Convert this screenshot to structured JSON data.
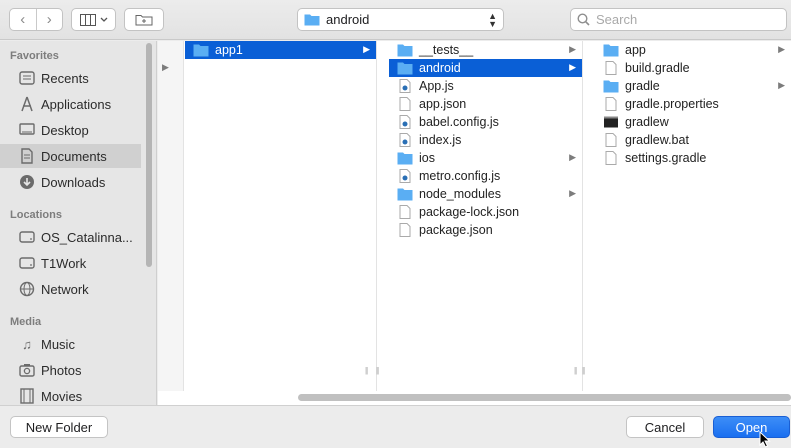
{
  "toolbar": {
    "path": "android",
    "search_placeholder": "Search"
  },
  "sidebar": {
    "favorites_title": "Favorites",
    "favorites": [
      {
        "label": "Recents",
        "icon": "clock-icon"
      },
      {
        "label": "Applications",
        "icon": "applications-icon"
      },
      {
        "label": "Desktop",
        "icon": "desktop-icon"
      },
      {
        "label": "Documents",
        "icon": "document-icon",
        "active": true
      },
      {
        "label": "Downloads",
        "icon": "download-icon"
      }
    ],
    "locations_title": "Locations",
    "locations": [
      {
        "label": "OS_Catalinna...",
        "icon": "disk-icon"
      },
      {
        "label": "T1Work",
        "icon": "disk-icon"
      },
      {
        "label": "Network",
        "icon": "network-icon"
      }
    ],
    "media_title": "Media",
    "media": [
      {
        "label": "Music",
        "icon": "music-icon"
      },
      {
        "label": "Photos",
        "icon": "camera-icon"
      },
      {
        "label": "Movies",
        "icon": "film-icon"
      }
    ]
  },
  "columns": {
    "col1": [
      {
        "name": "app1",
        "type": "folder",
        "selected": true,
        "has_children": true
      }
    ],
    "col2": [
      {
        "name": "__tests__",
        "type": "folder",
        "has_children": true
      },
      {
        "name": "android",
        "type": "folder",
        "selected": true,
        "has_children": true
      },
      {
        "name": "App.js",
        "type": "js-file"
      },
      {
        "name": "app.json",
        "type": "file"
      },
      {
        "name": "babel.config.js",
        "type": "js-file"
      },
      {
        "name": "index.js",
        "type": "js-file"
      },
      {
        "name": "ios",
        "type": "folder",
        "has_children": true
      },
      {
        "name": "metro.config.js",
        "type": "js-file"
      },
      {
        "name": "node_modules",
        "type": "folder",
        "has_children": true
      },
      {
        "name": "package-lock.json",
        "type": "file"
      },
      {
        "name": "package.json",
        "type": "file"
      }
    ],
    "col3": [
      {
        "name": "app",
        "type": "folder",
        "has_children": true
      },
      {
        "name": "build.gradle",
        "type": "file"
      },
      {
        "name": "gradle",
        "type": "folder",
        "has_children": true
      },
      {
        "name": "gradle.properties",
        "type": "file"
      },
      {
        "name": "gradlew",
        "type": "exec-file"
      },
      {
        "name": "gradlew.bat",
        "type": "file"
      },
      {
        "name": "settings.gradle",
        "type": "file"
      }
    ]
  },
  "buttons": {
    "new_folder": "New Folder",
    "cancel": "Cancel",
    "open": "Open"
  },
  "colors": {
    "selection": "#0a5fd6",
    "folder": "#5aaef3",
    "primary_button": "#1a6ff0"
  }
}
